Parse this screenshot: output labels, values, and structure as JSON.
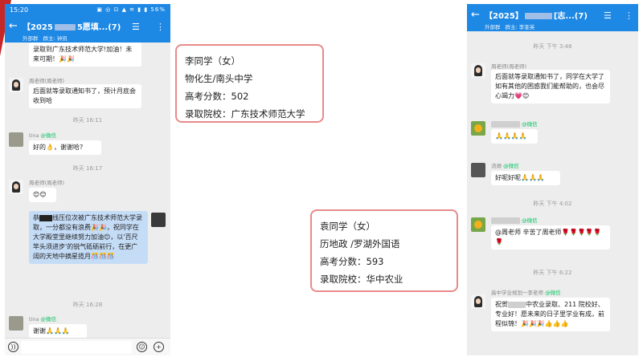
{
  "left_chat": {
    "status_time": "15:20",
    "status_icons": "▣ ◎ ⊡ ▲ ≋ ▮ ▮ 56%",
    "title_pre": "【2025",
    "title_post": "5愿填...(7)",
    "sub_dept": "外部群",
    "sub_owner": "群主: 钟凯",
    "messages": {
      "m0": "录取到广东技术师范大学!加油！未来可期！🎉🎉",
      "m1_name": "周老师(周老师)",
      "m1": "后面就等录取通知书了，预计月底会收到哈",
      "ts1": "昨天 16:11",
      "m2_name": "tina",
      "m2_wx": "@微信",
      "m2": "好的👌，谢谢哈?",
      "ts2": "昨天 16:17",
      "m3_name": "周老师(周老师)",
      "m3": "😊😊",
      "m4_a": "恭",
      "m4_b": "线压位次被广东技术师范大学录取，一分都没有浪费🎉🎉，祝同学在大学殿堂里继续努力加油😊，以'百尺竿头须进步'的锐气砥砺前行，在更广阔的天地中摘星揽月🎊🎊🎊",
      "ts3": "昨天 16:28",
      "m5_name": "tina",
      "m5_wx": "@微信",
      "m5": "谢谢🙏🙏🙏"
    }
  },
  "card1": {
    "name": "李同学（女）",
    "subjects": "物化生/南头中学",
    "score": "高考分数：502",
    "school": "录取院校：广东技术师范大学"
  },
  "card2": {
    "name": "袁同学（女）",
    "subjects": "历地政 /罗湖外国语",
    "score": "高考分数：593",
    "school": "录取院校：华中农业"
  },
  "right_chat": {
    "title_pre": "【2025】",
    "title_post": "[志...(7)",
    "sub_dept": "外部群",
    "sub_owner": "群主: 李奎英",
    "ts1": "昨天 下午 3:46",
    "m1_name": "周老师(周老师)",
    "m1": "后面就等录取通知书了，同学在大学了如有其他的困惑我们能帮助的，也会尽心竭力💗😊",
    "m2_wx": "@微信",
    "m2": "🙏🙏🙏🙏",
    "m3_name": "流顺",
    "m3_wx": "@微信",
    "m3": "好呢好呢🙏🙏🙏",
    "ts2": "昨天 下午 4:02",
    "m4_wx": "@微信",
    "m4": "@周老师 辛苦了周老师🌹🌹🌹🌹🌹🌹",
    "ts3": "昨天 下午 6:22",
    "m5_name": "高中学业规划一李老师",
    "m5_wx": "@微信",
    "m5_a": "祝贺",
    "m5_b": "中农业录取、211 院校好、专业好！愿未来的日子里学业有成，前程似锦！🎉🎉🎉👍👍👍"
  },
  "colors": {
    "header": "#1e88e5",
    "card_border": "#e88a8a",
    "chat_bg": "#ededed",
    "blue_bubble": "#c5dcf7"
  }
}
